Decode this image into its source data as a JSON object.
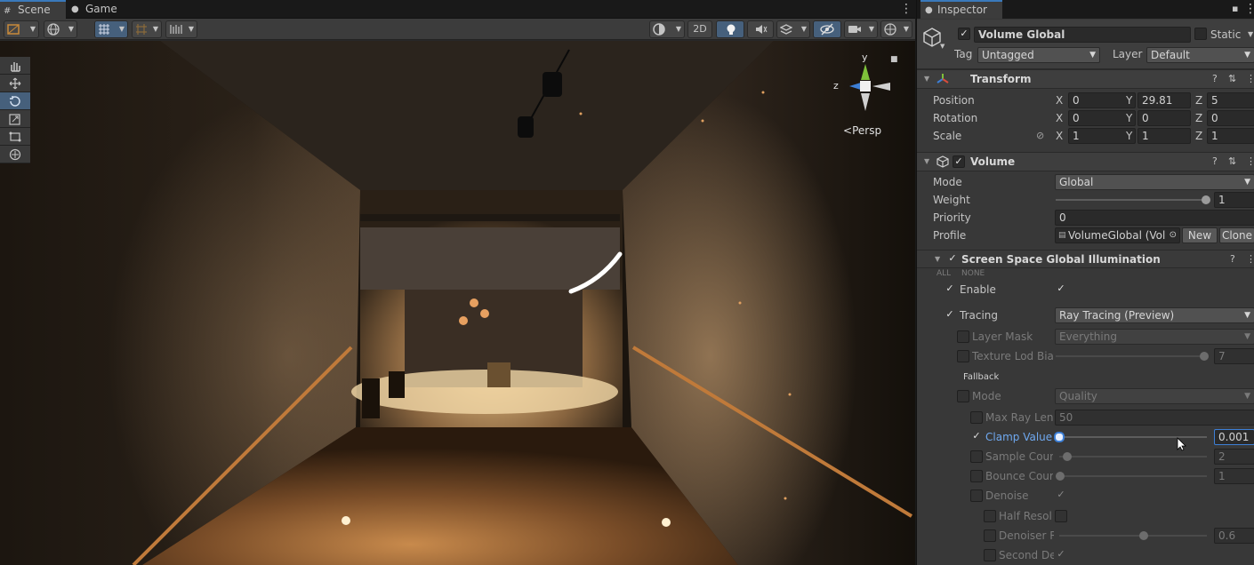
{
  "scene_tabs": [
    {
      "label": "Scene",
      "icon": "grid-icon"
    },
    {
      "label": "Game",
      "icon": "gamepad-icon"
    }
  ],
  "toolbar": {
    "mode_2d": "2D"
  },
  "gizmo": {
    "y_label": "y",
    "z_label": "z",
    "projection": "Persp",
    "projection_prefix": "<"
  },
  "inspector": {
    "tab_label": "Inspector",
    "object_name": "Volume Global",
    "object_enabled": "✓",
    "static_label": "Static",
    "tag_label": "Tag",
    "tag_value": "Untagged",
    "layer_label": "Layer",
    "layer_value": "Default",
    "transform": {
      "title": "Transform",
      "position_label": "Position",
      "rotation_label": "Rotation",
      "scale_label": "Scale",
      "position": {
        "x": "0",
        "y": "29.81",
        "z": "5"
      },
      "rotation": {
        "x": "0",
        "y": "0",
        "z": "0"
      },
      "scale": {
        "x": "1",
        "y": "1",
        "z": "1"
      },
      "axis_x": "X",
      "axis_y": "Y",
      "axis_z": "Z"
    },
    "volume": {
      "title": "Volume",
      "enabled": "✓",
      "mode_label": "Mode",
      "mode_value": "Global",
      "weight_label": "Weight",
      "weight_value": "1",
      "weight_fraction": 1.0,
      "priority_label": "Priority",
      "priority_value": "0",
      "profile_label": "Profile",
      "profile_value": "VolumeGlobal (Vol",
      "new_button": "New",
      "clone_button": "Clone"
    },
    "ssgi": {
      "title": "Screen Space Global Illumination",
      "enabled": "✓",
      "all_label": "ALL",
      "none_label": "NONE",
      "enable_label": "Enable",
      "enable_check": "✓",
      "enable_override": "✓",
      "tracing_label": "Tracing",
      "tracing_override": "✓",
      "tracing_value": "Ray Tracing (Preview)",
      "layer_mask_label": "Layer Mask",
      "layer_mask_value": "Everything",
      "texture_lod_label": "Texture Lod Bia",
      "texture_lod_value": "7",
      "texture_lod_fraction": 1.0,
      "fallback_label": "Fallback",
      "fb_mode_label": "Mode",
      "fb_mode_value": "Quality",
      "max_ray_label": "Max Ray Len",
      "max_ray_value": "50",
      "clamp_label": "Clamp Value",
      "clamp_override": "✓",
      "clamp_value": "0.001",
      "clamp_fraction": 0.0,
      "sample_label": "Sample Coun",
      "sample_value": "2",
      "sample_fraction": 0.02,
      "bounce_label": "Bounce Cour",
      "bounce_value": "1",
      "bounce_fraction": 0.0,
      "denoise_label": "Denoise",
      "denoise_check": "✓",
      "half_res_label": "Half Resolu",
      "denoiser_radius_label": "Denoiser R",
      "denoiser_radius_value": "0.6",
      "denoiser_radius_fraction": 0.57,
      "second_denoiser_label": "Second De",
      "second_denoiser_check": "✓"
    }
  },
  "colors": {
    "accent": "#3a79bb",
    "panel": "#383838",
    "scene_light": "#f0c88a"
  }
}
